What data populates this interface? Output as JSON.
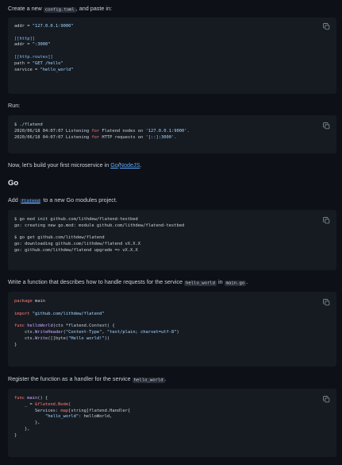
{
  "intro": {
    "before": "Create a new ",
    "file": "config.toml",
    "after": ", and paste in:"
  },
  "config_code": [
    [
      {
        "t": "addr = "
      },
      {
        "t": "\"127.0.0.1:9000\"",
        "c": "s"
      }
    ],
    [
      {
        "t": ""
      }
    ],
    [
      {
        "t": "[[http]]",
        "c": "c"
      }
    ],
    [
      {
        "t": "addr = "
      },
      {
        "t": "\":3000\"",
        "c": "s"
      }
    ],
    [
      {
        "t": ""
      }
    ],
    [
      {
        "t": "[[http.routes]]",
        "c": "c"
      }
    ],
    [
      {
        "t": "path = "
      },
      {
        "t": "\"GET /hello\"",
        "c": "s"
      }
    ],
    [
      {
        "t": "service = "
      },
      {
        "t": "\"hello_world\"",
        "c": "s"
      }
    ]
  ],
  "run_label": "Run:",
  "run_code": [
    [
      {
        "t": "$ ./flatend"
      }
    ],
    [
      {
        "t": "2020/06/18 04:07:07 Listening "
      },
      {
        "t": "for",
        "c": "k"
      },
      {
        "t": " Flatend nodes on "
      },
      {
        "t": "'127.0.0.1:9000'",
        "c": "s"
      },
      {
        "t": "."
      }
    ],
    [
      {
        "t": "2020/06/18 04:07:07 Listening "
      },
      {
        "t": "for",
        "c": "k"
      },
      {
        "t": " HTTP requests on "
      },
      {
        "t": "'[::]:3000'",
        "c": "s"
      },
      {
        "t": "."
      }
    ]
  ],
  "microservice": {
    "before": "Now, let's build your first microservice in ",
    "link_go": "Go",
    "slash": "/",
    "link_node": "NodeJS",
    "after": "."
  },
  "go_heading": "Go",
  "add": {
    "before": "Add ",
    "pkg": "flatend",
    "after": " to a new Go modules project."
  },
  "gomod_code": [
    [
      {
        "t": "$ go mod init github.com/lithdew/flatend-testbed"
      }
    ],
    [
      {
        "t": "go: creating new go.mod: module github.com/lithdew/flatend-testbed"
      }
    ],
    [
      {
        "t": ""
      }
    ],
    [
      {
        "t": "$ go get github.com/lithdew/flatend"
      }
    ],
    [
      {
        "t": "go: downloading github.com/lithdew/flatend vX.X.X"
      }
    ],
    [
      {
        "t": "go: github.com/lithdew/flatend upgrade => vX.X.X"
      }
    ]
  ],
  "write_fn": {
    "before": "Write a function that describes how to handle requests for the service ",
    "service": "hello_world",
    "mid": " in ",
    "file": "main.go",
    "after": "."
  },
  "handler_code": [
    [
      {
        "t": "package",
        "c": "k"
      },
      {
        "t": " main"
      }
    ],
    [
      {
        "t": ""
      }
    ],
    [
      {
        "t": "import",
        "c": "k"
      },
      {
        "t": " "
      },
      {
        "t": "\"github.com/lithdew/flatend\"",
        "c": "s"
      }
    ],
    [
      {
        "t": ""
      }
    ],
    [
      {
        "t": "func",
        "c": "k"
      },
      {
        "t": " "
      },
      {
        "t": "helloWorld",
        "c": "f"
      },
      {
        "t": "(ctx *flatend.Context) {"
      }
    ],
    [
      {
        "t": "    ctx."
      },
      {
        "t": "WriteHeader",
        "c": "f"
      },
      {
        "t": "("
      },
      {
        "t": "\"Content-Type\"",
        "c": "s"
      },
      {
        "t": ", "
      },
      {
        "t": "\"text/plain; charset=utf-8\"",
        "c": "s"
      },
      {
        "t": ")"
      }
    ],
    [
      {
        "t": "    ctx."
      },
      {
        "t": "Write",
        "c": "f"
      },
      {
        "t": "([]byte("
      },
      {
        "t": "\"Hello world!\"",
        "c": "s"
      },
      {
        "t": "))"
      }
    ],
    [
      {
        "t": "}"
      }
    ]
  ],
  "register": {
    "before": "Register the function as a handler for the service ",
    "service": "hello_world",
    "after": "."
  },
  "main_code": [
    [
      {
        "t": "func",
        "c": "k"
      },
      {
        "t": " "
      },
      {
        "t": "main",
        "c": "f"
      },
      {
        "t": "() {"
      }
    ],
    [
      {
        "t": "    _ = "
      },
      {
        "t": "&flatend.Node{",
        "c": "k"
      }
    ],
    [
      {
        "t": "        Services: "
      },
      {
        "t": "map",
        "c": "k"
      },
      {
        "t": "[string]flatend.Handler{"
      }
    ],
    [
      {
        "t": "            "
      },
      {
        "t": "\"hello_world\"",
        "c": "s"
      },
      {
        "t": ": helloWorld,"
      }
    ],
    [
      {
        "t": "        },"
      }
    ],
    [
      {
        "t": "    },"
      }
    ],
    [
      {
        "t": "}"
      }
    ]
  ]
}
